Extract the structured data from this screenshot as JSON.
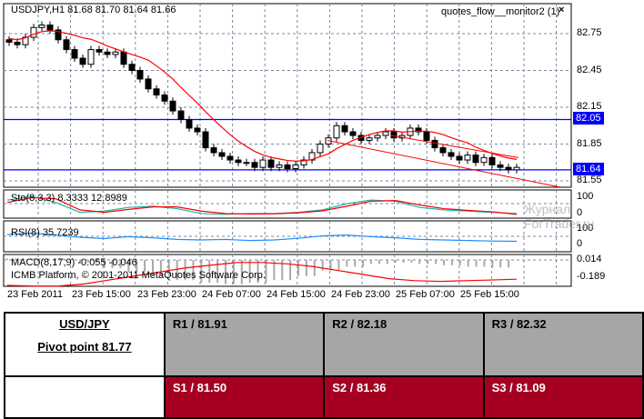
{
  "chart_window": {
    "title": "USDJPY,H1  81.68 81.70 81.64 81.66",
    "expert_label": "quotes_flow__monitor2 (1)",
    "close_icon": "close-icon",
    "price_axis": [
      "82.75",
      "82.45",
      "82.15",
      "81.85",
      "81.55"
    ],
    "level_tags": [
      "82.05",
      "81.64"
    ],
    "sto_label": "Sto(8,3,3) 8.3333 12.8989",
    "sto_axis": [
      "100",
      "0"
    ],
    "rsi_label": "RSI(8) 35.7239",
    "rsi_axis": [
      "100",
      "0"
    ],
    "macd_label": "MACD(8,17,9) -0.055 -0.046",
    "macd_axis": [
      "0.014",
      "-0.189"
    ],
    "copyright": "ICMB Platform, © 2001-2011 MetaQuotes Software Corp.",
    "time_axis": [
      "23 Feb 2011",
      "23 Feb 15:00",
      "23 Feb 23:00",
      "24 Feb 07:00",
      "24 Feb 15:00",
      "24 Feb 23:00",
      "25 Feb 07:00",
      "25 Feb 15:00"
    ],
    "watermark": "Журнал ForTrader.ru",
    "colors": {
      "ma": "#ff0000",
      "level": "#0000ff",
      "sto_main": "#20b2aa",
      "sto_signal": "#ff0000",
      "rsi": "#1e90ff",
      "macd_hist": "#a9a9a9"
    }
  },
  "chart_data": {
    "type": "candlestick",
    "symbol": "USDJPY",
    "timeframe": "H1",
    "ylim": [
      81.5,
      82.85
    ],
    "closes": [
      82.68,
      82.66,
      82.72,
      82.8,
      82.82,
      82.78,
      82.7,
      82.62,
      82.55,
      82.5,
      82.62,
      82.6,
      82.58,
      82.6,
      82.5,
      82.45,
      82.38,
      82.3,
      82.25,
      82.2,
      82.12,
      82.05,
      81.98,
      81.95,
      81.82,
      81.78,
      81.75,
      81.72,
      81.7,
      81.7,
      81.66,
      81.72,
      81.66,
      81.68,
      81.65,
      81.68,
      81.72,
      81.78,
      81.85,
      81.9,
      82.0,
      81.95,
      81.92,
      81.88,
      81.9,
      81.92,
      81.95,
      81.9,
      81.92,
      81.98,
      81.95,
      81.88,
      81.82,
      81.78,
      81.75,
      81.72,
      81.76,
      81.7,
      81.74,
      81.68,
      81.66,
      81.64,
      81.66
    ],
    "levels": [
      82.05,
      81.64
    ],
    "sto_main": [
      70,
      85,
      60,
      20,
      25,
      40,
      45,
      35,
      15,
      12,
      15,
      15,
      20,
      30,
      55,
      70,
      65,
      40,
      30,
      25,
      20,
      15
    ],
    "sto_signal": [
      60,
      80,
      75,
      30,
      20,
      32,
      42,
      42,
      25,
      15,
      13,
      14,
      18,
      26,
      45,
      65,
      68,
      50,
      35,
      28,
      22,
      12
    ],
    "rsi": [
      60,
      65,
      58,
      50,
      45,
      52,
      48,
      42,
      40,
      42,
      38,
      40,
      46,
      55,
      58,
      52,
      48,
      42,
      40,
      38,
      36,
      35
    ],
    "macd_hist": [
      0.01,
      0.012,
      0.01,
      -0.02,
      -0.06,
      -0.09,
      -0.12,
      -0.15,
      -0.17,
      -0.18,
      -0.17,
      -0.15,
      -0.12,
      -0.08,
      -0.05,
      -0.03,
      -0.02,
      -0.03,
      -0.04,
      -0.05,
      -0.055
    ],
    "macd_signal": [
      0.0,
      0.005,
      0.005,
      -0.01,
      -0.04,
      -0.07,
      -0.1,
      -0.13,
      -0.15,
      -0.17,
      -0.17,
      -0.16,
      -0.14,
      -0.11,
      -0.08,
      -0.05,
      -0.035,
      -0.03,
      -0.035,
      -0.04,
      -0.046
    ]
  },
  "pivot_table": {
    "pair": "USD/JPY",
    "pivot": "Pivot point 81.77",
    "r1": "R1 / 81.91",
    "r2": "R2 / 82.18",
    "r3": "R3 / 82.32",
    "s1": "S1 / 81.50",
    "s2": "S2 / 81.36",
    "s3": "S3 / 81.09",
    "colors": {
      "resistance": "#a6a6a6",
      "support": "#a50021"
    }
  }
}
